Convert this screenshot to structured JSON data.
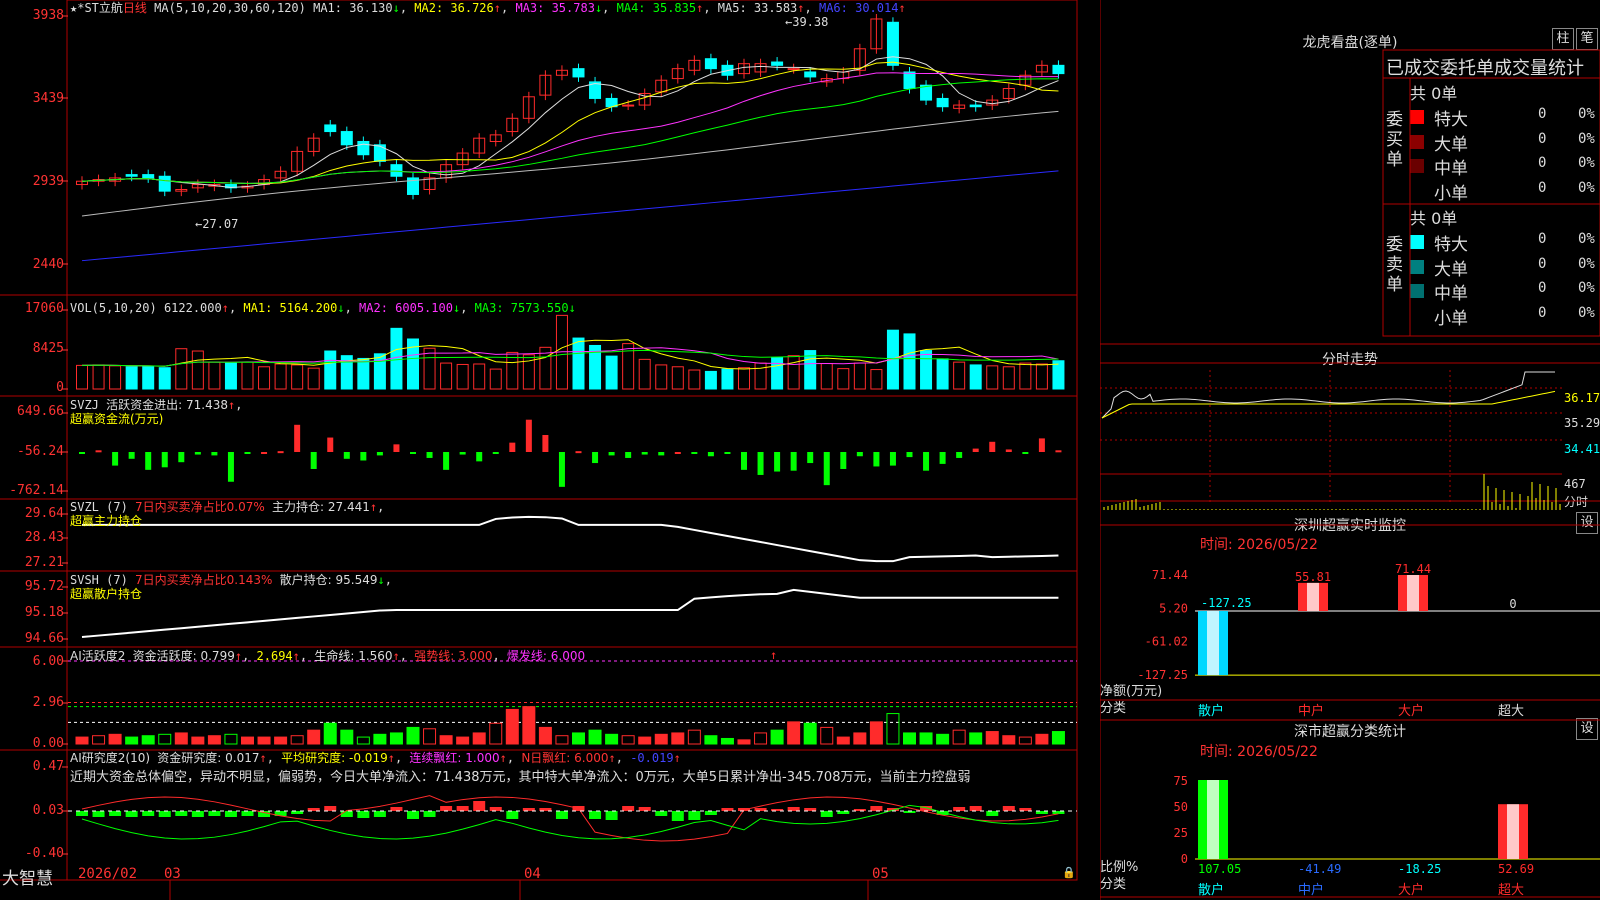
{
  "colors": {
    "up": "#ff2b2b",
    "down": "#00ffff",
    "green": "#00ff00",
    "yellow": "#ffff00",
    "magenta": "#ff33ff",
    "white": "#dddddd",
    "grey": "#bbbbbb",
    "blue": "#2a2aff",
    "frame": "#aa0000",
    "lightgreen": "#90ee90"
  },
  "main": {
    "title": "★*ST立航",
    "period": "日线",
    "ma_label": "MA(5,10,20,30,60,120)",
    "ma1": "MA1: 36.130",
    "ma2": "MA2: 36.726",
    "ma3": "MA3: 35.783",
    "ma4": "MA4: 35.835",
    "ma5": "MA5: 33.583",
    "ma6": "MA6: 30.014",
    "axis": [
      "3938",
      "3439",
      "2939",
      "2440"
    ],
    "high_label": "39.38",
    "low_label": "27.07"
  },
  "vol": {
    "label": "VOL(5,10,20)",
    "value": "6122.000",
    "ma1": "MA1: 5164.200",
    "ma2": "MA2: 6005.100",
    "ma3": "MA3: 7573.550",
    "axis": [
      "17060",
      "8425",
      "0"
    ]
  },
  "svzj": {
    "label": "SVZJ",
    "desc": "活跃资金进出: 71.438",
    "sub": "超赢资金流(万元)",
    "axis": [
      "649.66",
      "-56.24",
      "-762.14"
    ]
  },
  "svzl": {
    "label": "SVZL (7)",
    "desc": "7日内买卖净占比0.07%",
    "main": "主力持仓: 27.441",
    "sub": "超赢主力持仓",
    "axis": [
      "29.64",
      "28.43",
      "27.21"
    ]
  },
  "svsh": {
    "label": "SVSH (7)",
    "desc": "7日内买卖净占比0.143%",
    "main": "散户持仓: 95.549",
    "sub": "超赢散户持仓",
    "axis": [
      "95.72",
      "95.18",
      "94.66"
    ]
  },
  "ai1": {
    "label": "AI活跃度2",
    "a": "资金活跃度: 0.799",
    "b": "2.694",
    "c": "生命线: 1.560",
    "d": "强势线: 3.000",
    "e": "爆发线: 6.000",
    "axis": [
      "6.00",
      "2.96",
      "0.00"
    ]
  },
  "ai2": {
    "label": "AI研究度2(10)",
    "a": "资金研究度: 0.017",
    "b": "平均研究度: -0.019",
    "c": "连续飘红: 1.000",
    "d": "N日飘红: 6.000",
    "e": "-0.019",
    "comment": "近期大资金总体偏空，异动不明显，偏弱势，今日大单净流入：71.438万元，其中特大单净流入：0万元，大单5日累计净出-345.708万元，当前主力控盘弱",
    "axis": [
      "0.47",
      "0.03",
      "-0.40"
    ]
  },
  "bottom": {
    "brand": "大智慧",
    "dates": [
      "2026/02",
      "03",
      "04",
      "05"
    ]
  },
  "dragon": {
    "title": "龙虎看盘(逐单)",
    "btn1": "柱",
    "btn2": "笔",
    "tabs": "已成交委托单成交量统计",
    "buy_label": "委买单",
    "sell_label": "委卖单",
    "buy_total": "共 0单",
    "sell_total": "共 0单",
    "buy_rows": [
      {
        "name": "特大",
        "n": "0",
        "p": "0%"
      },
      {
        "name": "大单",
        "n": "0",
        "p": "0%"
      },
      {
        "name": "中单",
        "n": "0",
        "p": "0%"
      },
      {
        "name": "小单",
        "n": "0",
        "p": "0%"
      }
    ],
    "sell_rows": [
      {
        "name": "特大",
        "n": "0",
        "p": "0%"
      },
      {
        "name": "大单",
        "n": "0",
        "p": "0%"
      },
      {
        "name": "中单",
        "n": "0",
        "p": "0%"
      },
      {
        "name": "小单",
        "n": "0",
        "p": "0%"
      }
    ]
  },
  "intraday": {
    "title": "分时走势",
    "axis": [
      "36.17",
      "35.29",
      "34.41"
    ],
    "vol_axis": "467",
    "vol_unit": "分时"
  },
  "monitor": {
    "title": "深圳超赢实时监控",
    "btn": "设",
    "time": "时间: 2026/05/22",
    "axis": [
      "71.44",
      "5.20",
      "-61.02",
      "-127.25"
    ],
    "ylab": "净额(万元)",
    "xlab": "分类",
    "cats": [
      "散户",
      "中户",
      "大户",
      "超大"
    ],
    "values": [
      -127.25,
      55.81,
      71.44,
      0
    ],
    "labels": [
      "-127.25",
      "55.81",
      "71.44",
      "0"
    ]
  },
  "classify": {
    "title": "深市超赢分类统计",
    "btn": "设",
    "time": "时间: 2026/05/22",
    "axis": [
      "75",
      "50",
      "25",
      "0"
    ],
    "ylab": "比例%",
    "xlab": "分类",
    "cats": [
      "散户",
      "中户",
      "大户",
      "超大"
    ],
    "values": [
      107.05,
      -41.49,
      -18.25,
      52.69
    ],
    "labels": [
      "107.05",
      "-41.49",
      "-18.25",
      "52.69"
    ]
  }
}
